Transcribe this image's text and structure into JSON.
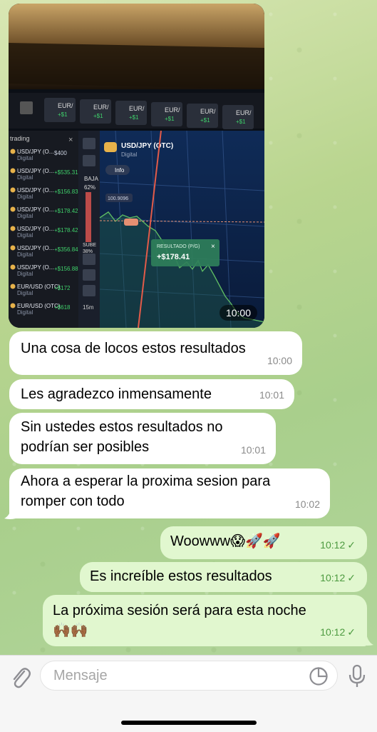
{
  "photo_message": {
    "time": "10:00",
    "screen": {
      "symbol": "USD/JPY (OTC)",
      "asset_type": "Digital",
      "info_label": "Info",
      "baja_label": "BAJA",
      "baja_pct": "62%",
      "sube_label": "SUBE",
      "sube_pct": "38%",
      "result_label": "RESULTADO (P/G)",
      "result_value": "+$178.41",
      "price_tag": "100.9096",
      "timeframe": "15m",
      "side_title": "trading",
      "tab_label": "EUR/",
      "tab_value": "+$1",
      "trades": [
        {
          "pair": "USD/JPY (O...",
          "type": "Digital",
          "value": "$400"
        },
        {
          "pair": "USD/JPY (O...",
          "type": "Digital",
          "value": "+$535.31"
        },
        {
          "pair": "USD/JPY (O...",
          "type": "Digital",
          "value": "+$156.83"
        },
        {
          "pair": "USD/JPY (O...",
          "type": "Digital",
          "value": "+$178.42"
        },
        {
          "pair": "USD/JPY (O...",
          "type": "Digital",
          "value": "+$178.42"
        },
        {
          "pair": "USD/JPY (O...",
          "type": "Digital",
          "value": "+$356.84"
        },
        {
          "pair": "USD/JPY (O...",
          "type": "Digital",
          "value": "+$156.88"
        },
        {
          "pair": "EUR/USD (OTC)",
          "type": "Digital",
          "value": "+$172"
        },
        {
          "pair": "EUR/USD (OTC)",
          "type": "Digital",
          "value": "+$618"
        }
      ]
    }
  },
  "incoming": [
    {
      "text": "Una cosa de locos estos resultados",
      "time": "10:00"
    },
    {
      "text": "Les agradezco inmensamente",
      "time": "10:01"
    },
    {
      "text": "Sin ustedes estos resultados no podrían ser posibles",
      "time": "10:01"
    },
    {
      "text": "Ahora a esperar la proxima sesion para romper con todo",
      "time": "10:02"
    }
  ],
  "outgoing": [
    {
      "text": "Woowww😱🚀🚀",
      "time": "10:12"
    },
    {
      "text": "Es increíble estos resultados",
      "time": "10:12"
    },
    {
      "text": "La próxima sesión será para esta noche",
      "emoji": "🙌🏾🙌🏾",
      "time": "10:12"
    }
  ],
  "input": {
    "placeholder": "Mensaje",
    "value": ""
  },
  "icons": [
    "paperclip-icon",
    "sticker-icon",
    "microphone-icon",
    "double-check-icon"
  ]
}
